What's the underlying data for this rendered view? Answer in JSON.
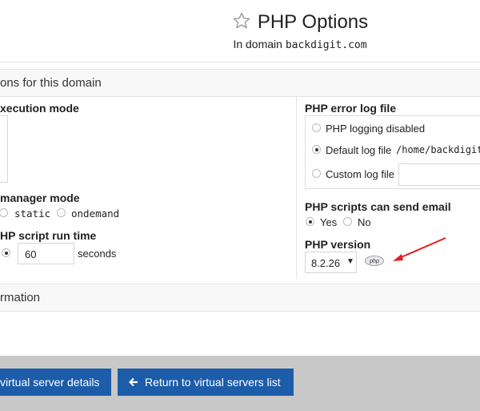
{
  "header": {
    "title": "PHP Options",
    "subtitle_prefix": "In domain ",
    "domain": "backdigit.com",
    "star_icon": "star-outline-icon"
  },
  "section_options": {
    "title": "ons for this domain"
  },
  "execution_mode": {
    "label": "xecution mode"
  },
  "manager_mode": {
    "label": "manager mode",
    "options": [
      "static",
      "ondemand"
    ]
  },
  "run_time": {
    "label": "HP script run time",
    "value": "60",
    "unit": "seconds"
  },
  "error_log": {
    "label": "PHP error log file",
    "opt_disabled": "PHP logging disabled",
    "opt_default": "Default log file",
    "default_path": "/home/backdigit",
    "opt_custom": "Custom log file",
    "custom_value": ""
  },
  "send_email": {
    "label": "PHP scripts can send email",
    "yes": "Yes",
    "no": "No",
    "selected": "Yes"
  },
  "php_version": {
    "label": "PHP version",
    "value": "8.2.26",
    "badge": "php"
  },
  "section_info": {
    "title": "rmation"
  },
  "buttons": {
    "details": "virtual server details",
    "return": "Return to virtual servers list"
  },
  "colors": {
    "button_bg": "#1c5ca8",
    "footer_bg": "#c8c8c8",
    "annotation_arrow": "#e02020"
  }
}
